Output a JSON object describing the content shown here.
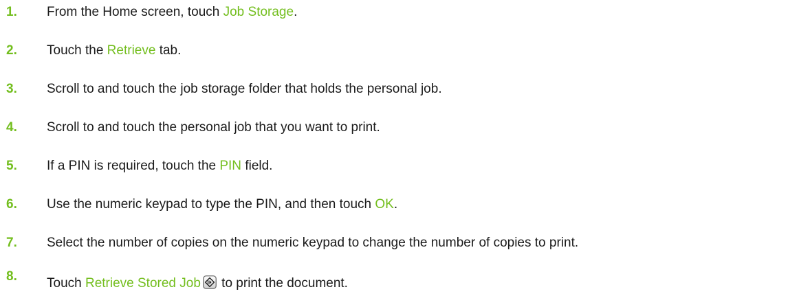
{
  "steps": [
    {
      "number": "1.",
      "before": "From the Home screen, touch ",
      "link": "Job Storage",
      "after": "."
    },
    {
      "number": "2.",
      "before": "Touch the ",
      "link": "Retrieve",
      "after": " tab."
    },
    {
      "number": "3.",
      "text": "Scroll to and touch the job storage folder that holds the personal job."
    },
    {
      "number": "4.",
      "text": "Scroll to and touch the personal job that you want to print."
    },
    {
      "number": "5.",
      "before": "If a PIN is required, touch the ",
      "link": "PIN",
      "after": " field."
    },
    {
      "number": "6.",
      "before": "Use the numeric keypad to type the PIN, and then touch ",
      "link": "OK",
      "after": "."
    },
    {
      "number": "7.",
      "text": "Select the number of copies on the numeric keypad to change the number of copies to print."
    },
    {
      "number": "8.",
      "before": "Touch ",
      "link": "Retrieve Stored Job",
      "icon": "start-button-icon",
      "after": " to print the document."
    }
  ],
  "colors": {
    "accent": "#73be1e",
    "text": "#1a1a1a"
  }
}
